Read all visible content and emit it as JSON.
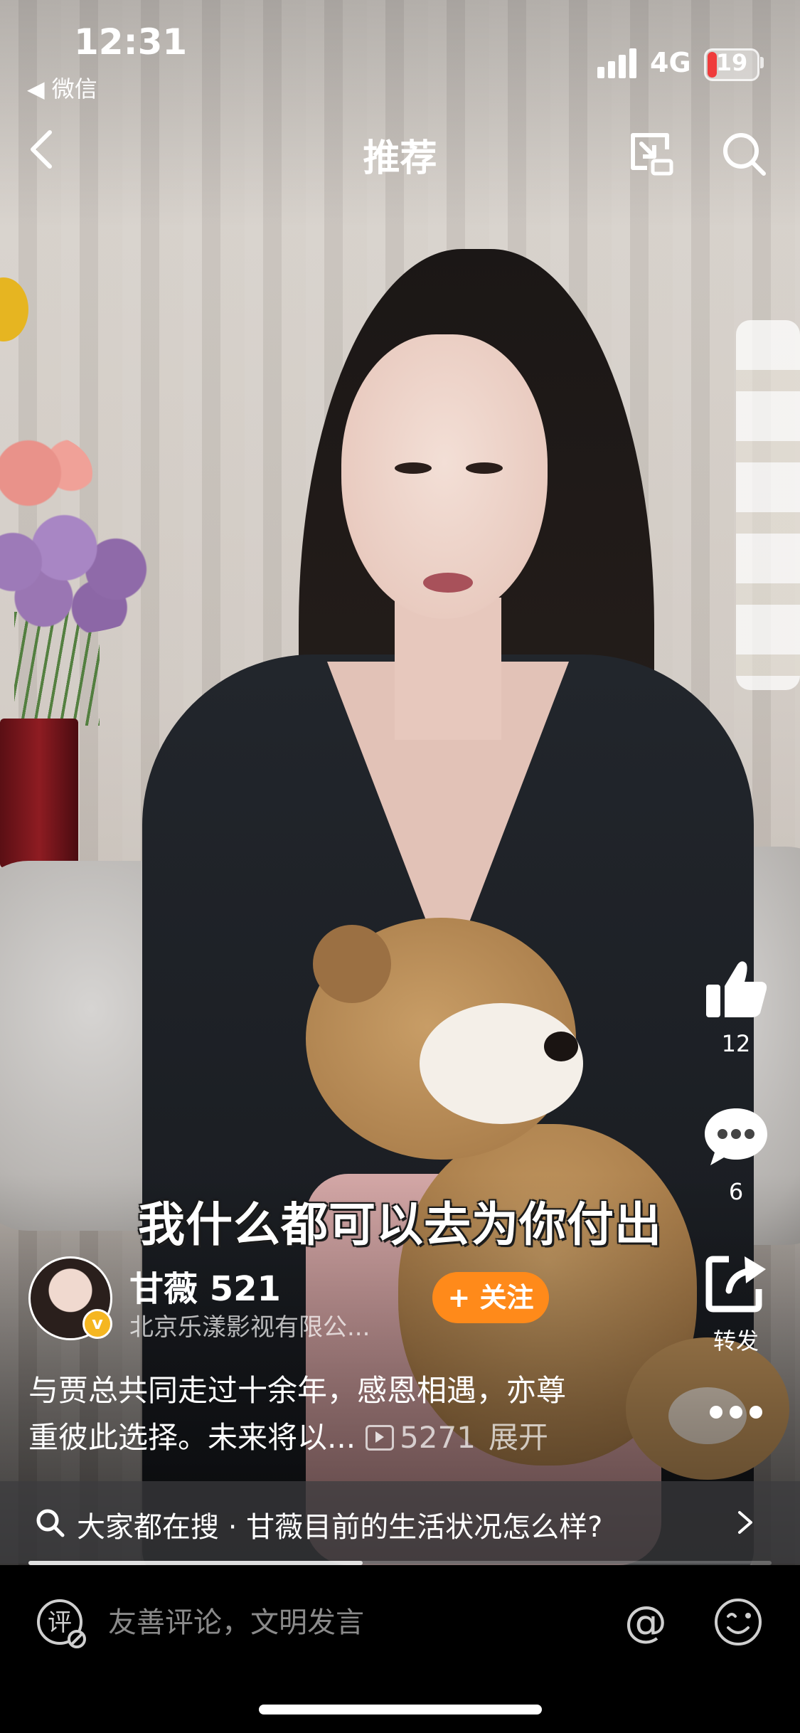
{
  "status_bar": {
    "time": "12:31",
    "back_app": "◀ 微信",
    "network": "4G",
    "battery": "19",
    "battery_level": 0.19
  },
  "nav": {
    "title": "推荐",
    "icons": [
      "back-chevron-icon",
      "cast-icon",
      "search-icon"
    ]
  },
  "video": {
    "subtitle": "我什么都可以去为你付出",
    "progress": 0.45
  },
  "rail": {
    "likes": "12",
    "comments": "6",
    "share_label": "转发"
  },
  "author": {
    "name": "甘薇 521",
    "org": "北京乐漾影视有限公...",
    "follow_label": "+ 关注"
  },
  "caption": {
    "text_line1": "与贾总共同走过十余年，感恩相遇，亦尊",
    "text_line2": "重彼此选择。未来将以...",
    "views": "5271",
    "expand": "展开"
  },
  "search_suggestion": {
    "text": "大家都在搜 · 甘薇目前的生活状况怎么样?"
  },
  "comment_bar": {
    "placeholder": "友善评论，文明发言",
    "comment_icon_glyph": "评",
    "at_glyph": "@"
  },
  "colors": {
    "follow": "#ff8a1a",
    "battery_low": "#ef3b3b",
    "verify_badge": "#f5b621"
  }
}
